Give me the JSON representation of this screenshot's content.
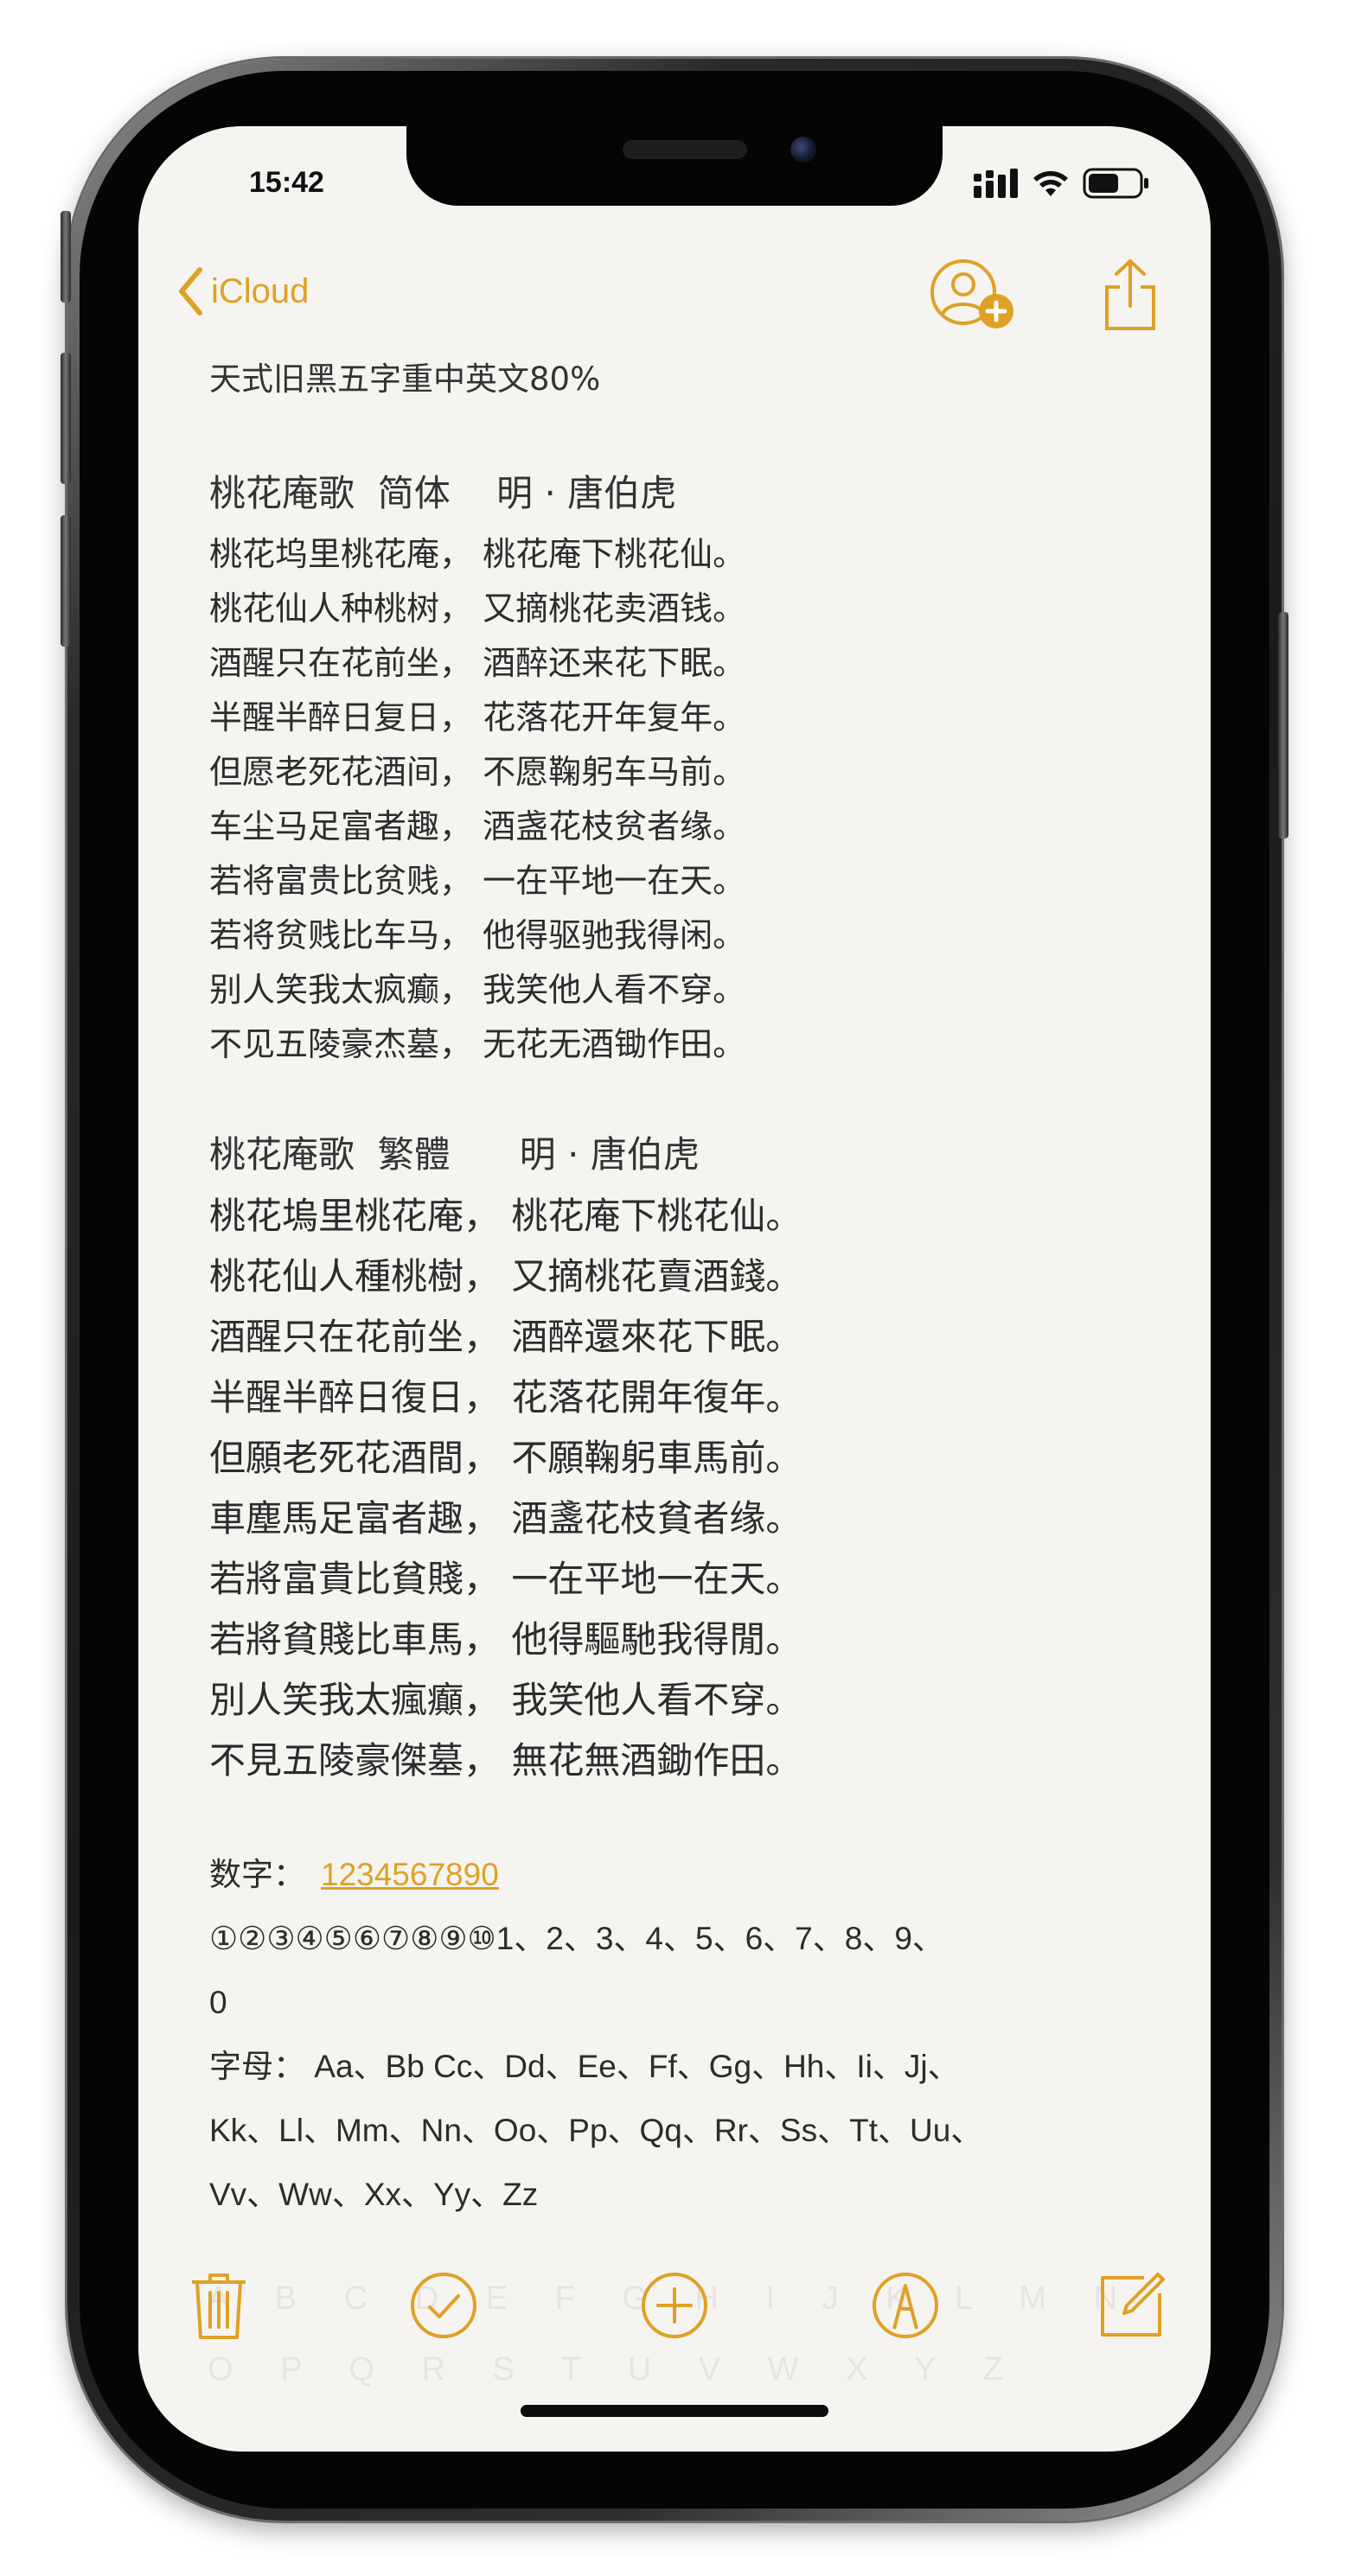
{
  "status_bar": {
    "time": "15:42"
  },
  "nav": {
    "back_label": "iCloud",
    "icons": [
      "chevron-left-icon",
      "add-people-icon",
      "share-icon"
    ]
  },
  "note": {
    "heading": "天式旧黑五字重中英文80%",
    "simplified": {
      "title": "桃花庵歌  简体    明 · 唐伯虎",
      "lines": [
        "桃花坞里桃花庵， 桃花庵下桃花仙。",
        "桃花仙人种桃树， 又摘桃花卖酒钱。",
        "酒醒只在花前坐， 酒醉还来花下眠。",
        "半醒半醉日复日， 花落花开年复年。",
        "但愿老死花酒间， 不愿鞠躬车马前。",
        "车尘马足富者趣， 酒盏花枝贫者缘。",
        "若将富贵比贫贱， 一在平地一在天。",
        "若将贫贱比车马， 他得驱驰我得闲。",
        "别人笑我太疯癫， 我笑他人看不穿。",
        "不见五陵豪杰墓， 无花无酒锄作田。"
      ]
    },
    "traditional": {
      "title": "桃花庵歌  繁體      明 · 唐伯虎",
      "lines": [
        "桃花塢里桃花庵， 桃花庵下桃花仙。",
        "桃花仙人種桃樹， 又摘桃花賣酒錢。",
        "酒醒只在花前坐， 酒醉還來花下眠。",
        "半醒半醉日復日， 花落花開年復年。",
        "但願老死花酒間， 不願鞠躬車馬前。",
        "車塵馬足富者趣， 酒盞花枝貧者缘。",
        "若將富貴比貧賤， 一在平地一在天。",
        "若將貧賤比車馬， 他得驅馳我得閒。",
        "別人笑我太瘋癲， 我笑他人看不穿。",
        "不見五陵豪傑墓， 無花無酒鋤作田。"
      ]
    },
    "digits_label": "数字：",
    "digits_link": "1234567890",
    "digits_line": "①②③④⑤⑥⑦⑧⑨⑩1、2、3、4、5、6、7、8、9、",
    "digits_line_end": "0",
    "letters_label": "字母：",
    "letters_line1": "Aa、Bb Cc、Dd、Ee、Ff、Gg、Hh、Ii、Jj、",
    "letters_line2": "Kk、Ll、Mm、Nn、Oo、Pp、Qq、Rr、Ss、Tt、Uu、",
    "letters_line3": "Vv、Ww、Xx、Yy、Zz",
    "faded_line1": "A B C D E F G H I J K L M N",
    "faded_line2": "O P Q R S T U V W X Y Z"
  },
  "toolbar": {
    "icons": [
      "trash-icon",
      "checklist-icon",
      "add-icon",
      "markup-icon",
      "compose-icon"
    ]
  },
  "colors": {
    "accent": "#dfa125",
    "paper": "#f5f4f1",
    "text": "#2c2c2c",
    "device": "#1a1a1a"
  }
}
